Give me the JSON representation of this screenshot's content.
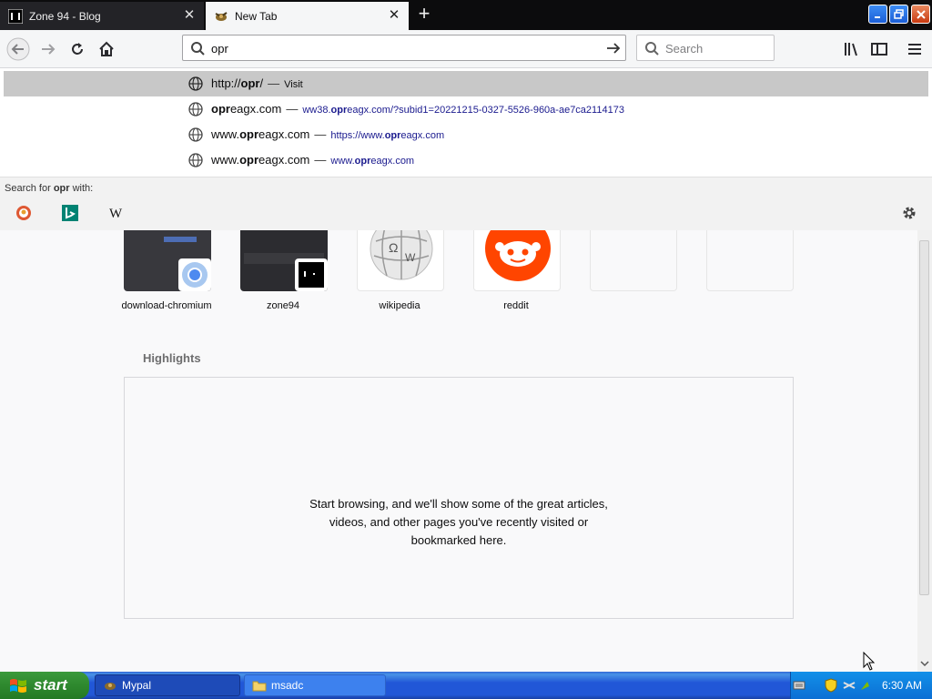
{
  "tabs": [
    {
      "title": "Zone 94 - Blog",
      "active": false
    },
    {
      "title": "New Tab",
      "active": true
    }
  ],
  "urlbar": {
    "value": "opr"
  },
  "searchbar": {
    "placeholder": "Search"
  },
  "suggestions": [
    {
      "pre": "http://",
      "bold": "opr",
      "post": "/",
      "action": "Visit"
    },
    {
      "bold": "opr",
      "post": "eagx.com",
      "url_pre": "ww38.",
      "url_bold": "opr",
      "url_post": "eagx.com/?subid1=20221215-0327-5526-960a-ae7ca2114173"
    },
    {
      "pre": "www.",
      "bold": "opr",
      "post": "eagx.com",
      "url_pre": "https://www.",
      "url_bold": "opr",
      "url_post": "eagx.com"
    },
    {
      "pre": "www.",
      "bold": "opr",
      "post": "eagx.com",
      "url_pre": "www.",
      "url_bold": "opr",
      "url_post": "eagx.com"
    }
  ],
  "oneoff": {
    "label_pre": "Search for ",
    "label_bold": "opr",
    "label_post": " with:"
  },
  "topsites": [
    {
      "label": "download-chromium"
    },
    {
      "label": "zone94"
    },
    {
      "label": "wikipedia"
    },
    {
      "label": "reddit"
    }
  ],
  "highlights": {
    "title": "Highlights",
    "line1": "Start browsing, and we'll show some of the great articles,",
    "line2": "videos, and other pages you've recently visited or",
    "line3": "bookmarked here."
  },
  "taskbar": {
    "start": "start",
    "tasks": [
      {
        "label": "Mypal"
      },
      {
        "label": "msadc"
      }
    ],
    "clock": "6:30 AM"
  },
  "colors": {
    "reddit": "#ff4500",
    "xp_blue": "#2157d7",
    "start_green": "#2f8a2f"
  }
}
